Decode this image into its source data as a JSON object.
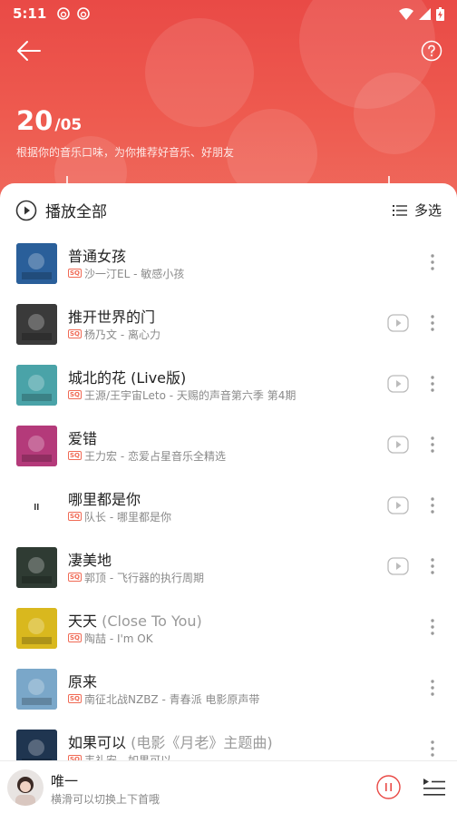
{
  "status_bar": {
    "time": "5:11"
  },
  "header": {
    "day": "20",
    "month": "/05",
    "subtitle": "根据你的音乐口味，为你推荐好音乐、好朋友"
  },
  "toolbar": {
    "play_all_label": "播放全部",
    "multi_select_label": "多选"
  },
  "quality_badge": "SQ",
  "songs": [
    {
      "title": "普通女孩",
      "title_suffix": "",
      "meta": "沙一汀EL - 敏感小孩",
      "has_mv": false,
      "cover_color": "#2a5f9a"
    },
    {
      "title": "推开世界的门",
      "title_suffix": "",
      "meta": "杨乃文 - 离心力",
      "has_mv": true,
      "cover_color": "#3a3a3a"
    },
    {
      "title": "城北的花 (Live版)",
      "title_suffix": "",
      "meta": "王源/王宇宙Leto - 天赐的声音第六季 第4期",
      "has_mv": true,
      "cover_color": "#4aa3a8"
    },
    {
      "title": "爱错",
      "title_suffix": "",
      "meta": "王力宏 - 恋爱占星音乐全精选",
      "has_mv": true,
      "cover_color": "#b43a7a"
    },
    {
      "title": "哪里都是你",
      "title_suffix": "",
      "meta": "队长 - 哪里都是你",
      "has_mv": true,
      "cover_color": "#ffffff"
    },
    {
      "title": "凄美地",
      "title_suffix": "",
      "meta": "郭顶 - 飞行器的执行周期",
      "has_mv": true,
      "cover_color": "#2f3b33"
    },
    {
      "title": "天天",
      "title_suffix": " (Close To You)",
      "meta": "陶喆 - I'm OK",
      "has_mv": false,
      "cover_color": "#d9b81e"
    },
    {
      "title": "原来",
      "title_suffix": "",
      "meta": "南征北战NZBZ - 青春派 电影原声带",
      "has_mv": false,
      "cover_color": "#7aa7c9"
    },
    {
      "title": "如果可以",
      "title_suffix": " (电影《月老》主题曲)",
      "meta": "韦礼安 - 如果可以",
      "has_mv": false,
      "cover_color": "#1f3550"
    }
  ],
  "mini_player": {
    "title": "唯一",
    "hint": "横滑可以切换上下首哦"
  },
  "colors": {
    "accent": "#e94a46",
    "badge": "#f06a55"
  }
}
